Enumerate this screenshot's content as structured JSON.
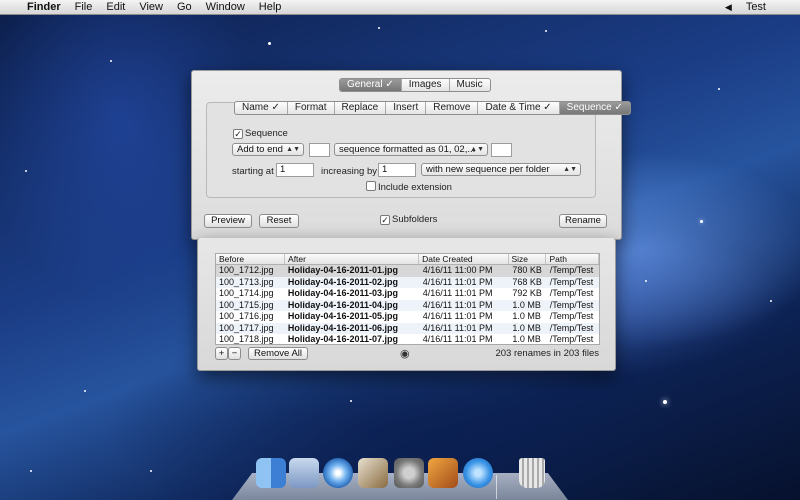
{
  "menubar": {
    "apple_glyph": "",
    "app_name": "Finder",
    "items": [
      "File",
      "Edit",
      "View",
      "Go",
      "Window",
      "Help"
    ],
    "volume_glyph": "◀",
    "user": "Test"
  },
  "top_tabs": [
    {
      "label": "General ✓",
      "selected": true
    },
    {
      "label": "Images",
      "selected": false
    },
    {
      "label": "Music",
      "selected": false
    }
  ],
  "sub_tabs": [
    {
      "label": "Name ✓",
      "selected": false
    },
    {
      "label": "Format",
      "selected": false
    },
    {
      "label": "Replace",
      "selected": false
    },
    {
      "label": "Insert",
      "selected": false
    },
    {
      "label": "Remove",
      "selected": false
    },
    {
      "label": "Date & Time ✓",
      "selected": false
    },
    {
      "label": "Sequence ✓",
      "selected": true
    }
  ],
  "sequence": {
    "checkbox_label": "Sequence",
    "checkbox_mark": "✓",
    "position_popup": "Add to end",
    "format_popup": "sequence formatted as 01, 02,...",
    "popup_arrow": "▲▼",
    "starting_label": "starting at",
    "starting_value": "1",
    "increasing_label": "increasing by",
    "increasing_value": "1",
    "folder_popup": "with new sequence per folder",
    "include_ext_label": "Include extension"
  },
  "bottom_bar": {
    "preview": "Preview",
    "reset": "Reset",
    "subfolders": "Subfolders",
    "subfolders_mark": "✓",
    "rename": "Rename"
  },
  "table": {
    "columns": [
      "Before",
      "After",
      "Date Created",
      "Size",
      "Path"
    ],
    "rows": [
      [
        "100_1712.jpg",
        "Holiday-04-16-2011-01.jpg",
        "4/16/11 11:00 PM",
        "780 KB",
        "/Temp/Test"
      ],
      [
        "100_1713.jpg",
        "Holiday-04-16-2011-02.jpg",
        "4/16/11 11:01 PM",
        "768 KB",
        "/Temp/Test"
      ],
      [
        "100_1714.jpg",
        "Holiday-04-16-2011-03.jpg",
        "4/16/11 11:01 PM",
        "792 KB",
        "/Temp/Test"
      ],
      [
        "100_1715.jpg",
        "Holiday-04-16-2011-04.jpg",
        "4/16/11 11:01 PM",
        "1.0 MB",
        "/Temp/Test"
      ],
      [
        "100_1716.jpg",
        "Holiday-04-16-2011-05.jpg",
        "4/16/11 11:01 PM",
        "1.0 MB",
        "/Temp/Test"
      ],
      [
        "100_1717.jpg",
        "Holiday-04-16-2011-06.jpg",
        "4/16/11 11:01 PM",
        "1.0 MB",
        "/Temp/Test"
      ],
      [
        "100_1718.jpg",
        "Holiday-04-16-2011-07.jpg",
        "4/16/11 11:01 PM",
        "1.0 MB",
        "/Temp/Test"
      ]
    ]
  },
  "list_footer": {
    "add": "+",
    "remove_one": "−",
    "remove_all": "Remove All",
    "eye_glyph": "◉",
    "summary": "203 renames in 203 files"
  },
  "colors": {
    "selected_tab": "#7f7f7f",
    "desktop": "#1b3d86"
  }
}
